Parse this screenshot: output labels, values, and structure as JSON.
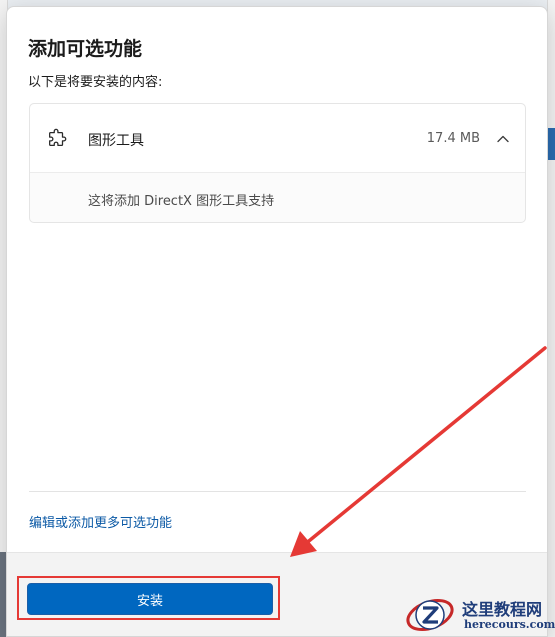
{
  "dialog": {
    "title": "添加可选功能",
    "subtitle": "以下是将要安装的内容:"
  },
  "feature": {
    "icon": "puzzle-icon",
    "name": "图形工具",
    "size": "17.4 MB",
    "expanded": true,
    "description": "这将添加 DirectX 图形工具支持"
  },
  "links": {
    "more_features": "编辑或添加更多可选功能"
  },
  "footer": {
    "install_label": "安装"
  },
  "annotation": {
    "highlight_color": "#e53935"
  },
  "watermark": {
    "title": "这里教程网",
    "url": "herecours.com"
  },
  "colors": {
    "accent": "#0067c0",
    "link": "#0c5aa6"
  }
}
